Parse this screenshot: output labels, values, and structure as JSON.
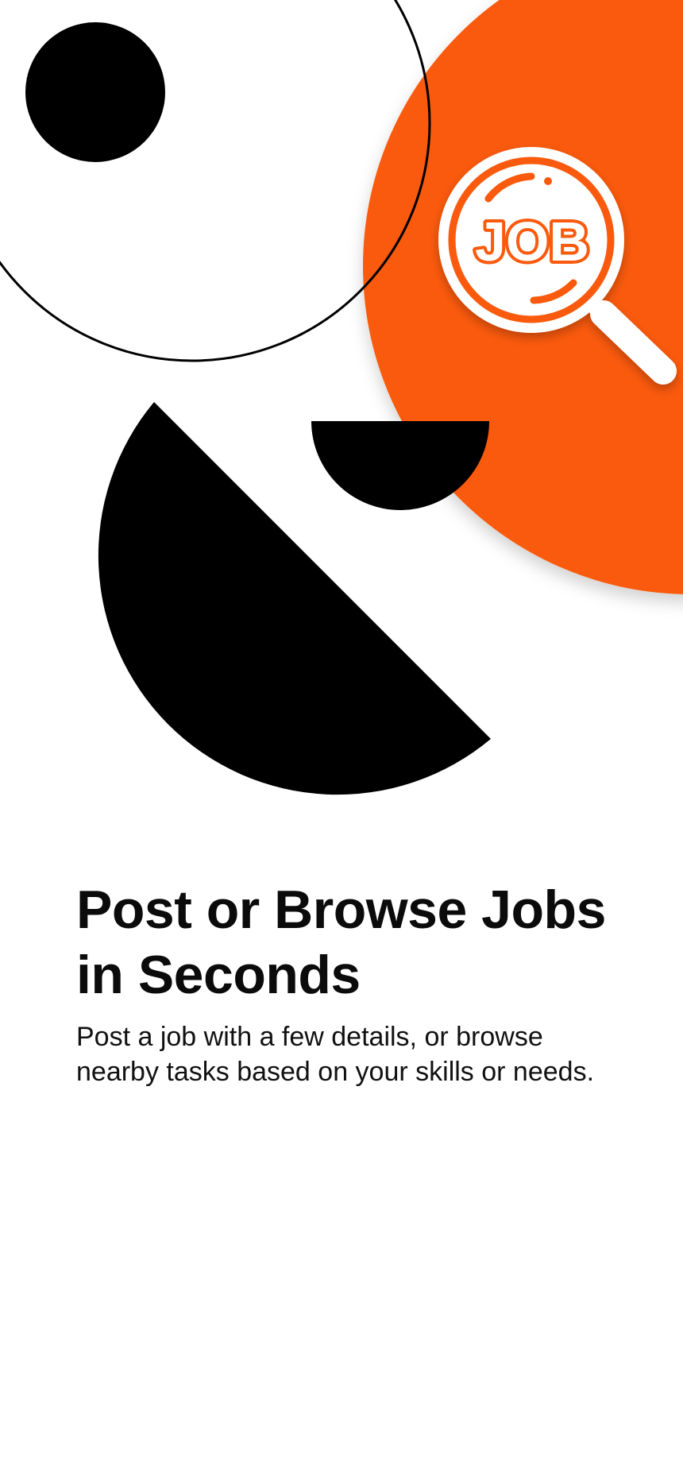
{
  "onboarding": {
    "title": "Post or Browse Jobs in Seconds",
    "description": "Post a job with a few details, or browse nearby tasks based on your skills or needs."
  },
  "illustration": {
    "badge_text": "JOB",
    "icon": "job-search-magnifier-icon",
    "accent_color": "#FA5A0A",
    "shape_color": "#000000",
    "background_color": "#FFFFFF"
  }
}
